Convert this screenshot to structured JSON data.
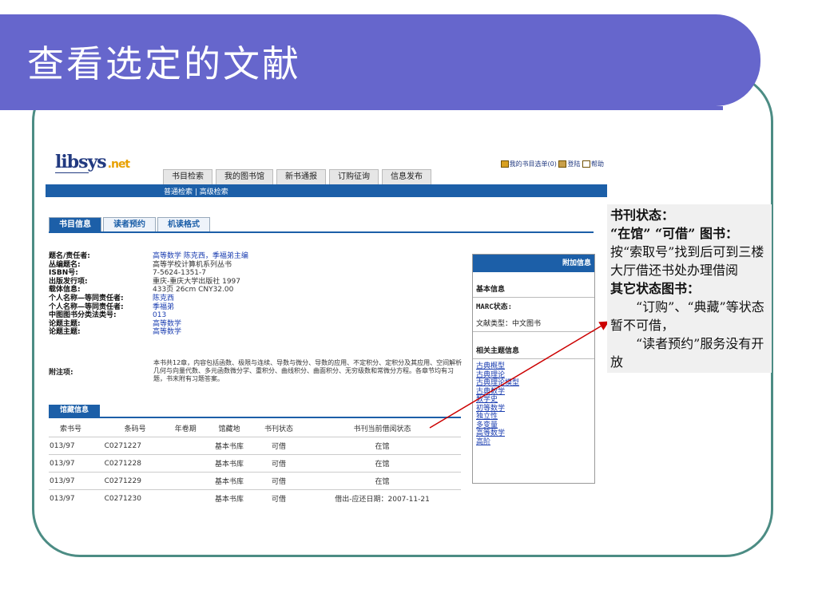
{
  "slide": {
    "title": "查看选定的文献"
  },
  "app": {
    "logo_main": "libsys",
    "logo_sub": ".net",
    "top_links": [
      "我的书目选单(0)",
      "登陆",
      "帮助"
    ],
    "nav_tabs": [
      "书目检索",
      "我的图书馆",
      "新书通报",
      "订购征询",
      "信息发布"
    ],
    "subnav": "普通检索 | 高级检索",
    "content_tabs": [
      "书目信息",
      "读者预约",
      "机读格式"
    ]
  },
  "record": {
    "fields": [
      {
        "label": "题名/责任者:",
        "value": "高等数学 陈克西，季福弟主编",
        "link": true
      },
      {
        "label": "丛编题名:",
        "value": "高等学校计算机系列丛书",
        "link": false
      },
      {
        "label": "ISBN号:",
        "value": "7-5624-1351-7",
        "link": false
      },
      {
        "label": "出版发行项:",
        "value": "重庆-重庆大学出版社 1997",
        "link": false
      },
      {
        "label": "载体信息:",
        "value": "433页 26cm CNY32.00",
        "link": false
      },
      {
        "label": "个人名称—等同责任者:",
        "value": "陈克西",
        "link": true
      },
      {
        "label": "个人名称—等同责任者:",
        "value": "季福弟",
        "link": true
      },
      {
        "label": "中图图书分类法类号:",
        "value": "013",
        "link": true
      },
      {
        "label": "论题主题:",
        "value": "高等数学",
        "link": true
      },
      {
        "label": "论题主题:",
        "value": "高等数学",
        "link": true
      }
    ],
    "note_label": "附注项:",
    "note": "本书共12章，内容包括函数、极限与连续、导数与微分、导数的应用、不定积分、定积分及其应用、空间解析几何与向量代数、多元函数微分学、重积分、曲线积分、曲面积分、无穷级数和常微分方程。各章节均有习题，书末附有习题答案。"
  },
  "holdings": {
    "tab": "馆藏信息",
    "columns": [
      "索书号",
      "条码号",
      "年卷期",
      "馆藏地",
      "书刊状态",
      "书刊当前借阅状态"
    ],
    "rows": [
      [
        "013/97",
        "C0271227",
        "",
        "基本书库",
        "可借",
        "在馆"
      ],
      [
        "013/97",
        "C0271228",
        "",
        "基本书库",
        "可借",
        "在馆"
      ],
      [
        "013/97",
        "C0271229",
        "",
        "基本书库",
        "可借",
        "在馆"
      ],
      [
        "013/97",
        "C0271230",
        "",
        "基本书库",
        "可借",
        "借出-应还日期：2007-11-21"
      ]
    ]
  },
  "side": {
    "head": "附加信息",
    "basic": "基本信息",
    "marc": "MARC状态:",
    "doc_type": "文献类型：中文图书",
    "related": "相关主题信息",
    "topics": [
      "古典概型",
      "古典理论",
      "古典理论模型",
      "古典数学",
      "数学史",
      "初等数学",
      "独立性",
      "多变量",
      "高等数学",
      "高阶"
    ]
  },
  "callout": {
    "l1": "书刊状态：",
    "l2": "“在馆”  “可借”  图书：",
    "l3": "按“索取号”找到后可到三楼大厅借还书处办理借阅",
    "l4": "其它状态图书：",
    "l5": "“订购”、“典藏”等状态暂不可借，",
    "l6": "“读者预约”服务没有开放"
  },
  "colors": {
    "banner": "#6666cc",
    "frame": "#4c8c84",
    "app_blue": "#1c5fa8",
    "arrow": "#cc0000"
  }
}
